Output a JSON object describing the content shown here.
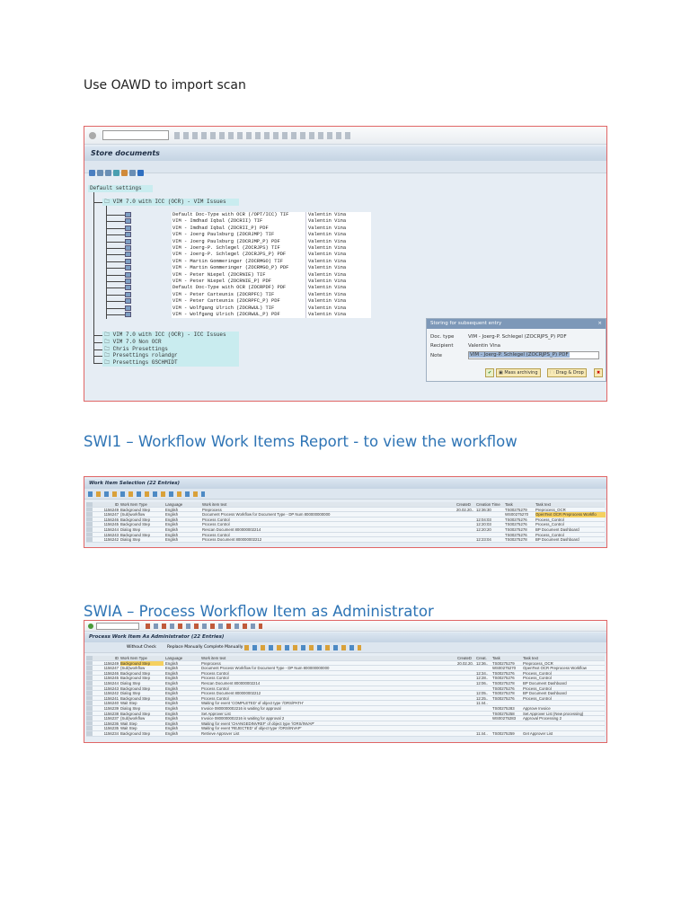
{
  "intro": "Use OAWD to import scan",
  "oawd": {
    "title": "Store documents",
    "default_settings": "Default settings",
    "open_node": "VIM 7.0 with ICC (OCR) - VIM Issues",
    "entries": [
      [
        "Default Doc-Type with OCR (/OPT/ICC) TIF",
        "Valentin Vina"
      ],
      [
        "VIM - Imdhad Iqbal (ZOCRII) TIF",
        "Valentin Vina"
      ],
      [
        "VIM - Imdhad Iqbal (ZOCRII_P) PDF",
        "Valentin Vina"
      ],
      [
        "VIM - Joerg Paulsburg (ZOCRJMP) TIF",
        "Valentin Vina"
      ],
      [
        "VIM - Joerg Paulsburg (ZOCRJMP_P) PDF",
        "Valentin Vina"
      ],
      [
        "VIM - Joerg-P. Schlegel (ZOCRJPS) TIF",
        "Valentin Vina"
      ],
      [
        "VIM - Joerg-P. Schlegel (ZOCRJPS_P) PDF",
        "Valentin Vina"
      ],
      [
        "VIM - Martin Gommeringer (ZOCRMGO) TIF",
        "Valentin Vina"
      ],
      [
        "VIM - Martin Gommeringer (ZOCRMGO_P) PDF",
        "Valentin Vina"
      ],
      [
        "VIM - Peter Niepel (ZOCRNIE) TIF",
        "Valentin Vina"
      ],
      [
        "VIM - Peter Niepel (ZOCRNIE_P) PDF",
        "Valentin Vina"
      ],
      [
        "Default Doc-Type with OCR (ZOCRPDF) PDF",
        "Valentin Vina"
      ],
      [
        "VIM - Peter Carteunis (ZOCRPFC) TIF",
        "Valentin Vina"
      ],
      [
        "VIM - Peter Carteunis (ZOCRPFC_P) PDF",
        "Valentin Vina"
      ],
      [
        "VIM - Wolfgang Ulrich (ZOCRWUL) TIF",
        "Valentin Vina"
      ],
      [
        "VIM - Wolfgang Ulrich (ZOCRWUL_P) PDF",
        "Valentin Vina"
      ]
    ],
    "closed_nodes": [
      "VIM 7.0 with ICC (OCR) - ICC Issues",
      "VIM 7.0 Non OCR",
      "Chris Presettings",
      "Presettings rolandgr",
      "Presettings GSCHMIDT"
    ],
    "dialog": {
      "title": "Storing for subsequent entry",
      "doc_type_label": "Doc. type",
      "doc_type": "VIM - Joerg-P. Schlegel (ZOCRJPS_P) PDF",
      "recipient_label": "Recipient",
      "recipient": "Valentin Vina",
      "note_label": "Note",
      "note": "VIM - Joerg-P. Schlegel (ZOCRJPS_P) PDF",
      "mass_archiving": "Mass archiving",
      "drag_drop": "Drag & Drop"
    }
  },
  "swi1_heading": "SWI1 – Workflow Work Items Report   -  to view the workflow",
  "swi1": {
    "title": "Work Item Selection (22 Entries)",
    "columns": [
      "ID",
      "Work Item Type",
      "Language",
      "Work item text",
      "CreateD",
      "Creation Time",
      "Task",
      "Task text"
    ],
    "rows": [
      [
        "1156249",
        "Background Step",
        "English",
        "Preprocess",
        "20.02.20..",
        "12:36:30",
        "TS00275279",
        "Preprocess_OCR"
      ],
      [
        "1156247",
        "(Sub)workflow",
        "English",
        "Document Process Workflow for Document Type  - DP Num 800000000000",
        "",
        "",
        "WS00275270",
        "OpenText OCR Preprocess Workflo"
      ],
      [
        "1156246",
        "Background Step",
        "English",
        "Process Control",
        "",
        "12:04:03",
        "TS00275276",
        "Process_Control"
      ],
      [
        "1156245",
        "Background Step",
        "English",
        "Process Control",
        "",
        "12:20:03",
        "TS00275276",
        "Process_Control"
      ],
      [
        "1156244",
        "Dialog Step",
        "English",
        "Rescan Document 800000002214",
        "",
        "12:20:20",
        "TS00275278",
        "BP Document Dashboard"
      ],
      [
        "1156243",
        "Background Step",
        "English",
        "Process Control",
        "",
        "",
        "TS00275276",
        "Process_Control"
      ],
      [
        "1156242",
        "Dialog Step",
        "English",
        "Process Document 800000002212",
        "",
        "12:23:04",
        "TS00275278",
        "BP Document Dashboard"
      ]
    ]
  },
  "swia_heading": "SWIA – Process Workflow Item as Administrator",
  "swia": {
    "title": "Process Work Item As Administrator (22 Entries)",
    "toolbar": [
      "Without Check",
      "Replace Manually",
      "Complete Manually"
    ],
    "columns": [
      "ID",
      "Work Item Type",
      "Language",
      "Work item text",
      "CreateD",
      "Creat.",
      "Task",
      "Task text"
    ],
    "rows": [
      [
        "1156249",
        "Background Step",
        "English",
        "Preprocess",
        "20.02.20.",
        "12:36..",
        "TS00275279",
        "Preprocess_OCR"
      ],
      [
        "1156247",
        "(Sub)workflow",
        "English",
        "Document Process Workflow for Document Type  - DP Num 800000000000",
        "",
        "",
        "WS00275270",
        "OpenText OCR Preprocess Workflow"
      ],
      [
        "1156246",
        "Background Step",
        "English",
        "Process Control",
        "",
        "12:34..",
        "TS00275276",
        "Process_Control"
      ],
      [
        "1156245",
        "Background Step",
        "English",
        "Process Control",
        "",
        "12:28..",
        "TS00275276",
        "Process_Control"
      ],
      [
        "1156244",
        "Dialog Step",
        "English",
        "Rescan Document 800000002214",
        "",
        "12:06..",
        "TS00275278",
        "BP Document Dashboard"
      ],
      [
        "1156243",
        "Background Step",
        "English",
        "Process Control",
        "",
        "",
        "TS00275276",
        "Process_Control"
      ],
      [
        "1156242",
        "Dialog Step",
        "English",
        "Process Document 800000002212",
        "",
        "12:05..",
        "TS00275278",
        "BP Document Dashboard"
      ],
      [
        "1156241",
        "Background Step",
        "English",
        "Process Control",
        "",
        "12:25..",
        "TS00275276",
        "Process_Control"
      ],
      [
        "1156240",
        "Wait Step",
        "English",
        "Waiting for event 'COMPLETED' of object type '/ORS/PATH'",
        "",
        "11:44..",
        "",
        ""
      ],
      [
        "1156239",
        "Dialog Step",
        "English",
        "Invoice 0800000002216 is waiting for approval",
        "",
        "",
        "TS00275283",
        "Approve Invoice"
      ],
      [
        "1156238",
        "Background Step",
        "English",
        "Set Approver List",
        "",
        "",
        "TS00275258",
        "Set Approver List (New processing)"
      ],
      [
        "1156237",
        "(Sub)workflow",
        "English",
        "Invoice 0800000002216 is waiting for approval 2",
        "",
        "",
        "WS00275283",
        "Approval Processing 2"
      ],
      [
        "1156236",
        "Wait Step",
        "English",
        "Waiting for event 'CHANGEDINVREF' of object type '/ORS/INVAP'",
        "",
        "",
        "",
        ""
      ],
      [
        "1156235",
        "Wait Step",
        "English",
        "Waiting for event 'REJECTED' of object type '/ORS/INVAP'",
        "",
        "",
        "",
        ""
      ],
      [
        "1156234",
        "Background Step",
        "English",
        "Retrieve Approver List",
        "",
        "11:44..",
        "TS00275259",
        "Get Approver List"
      ]
    ]
  }
}
